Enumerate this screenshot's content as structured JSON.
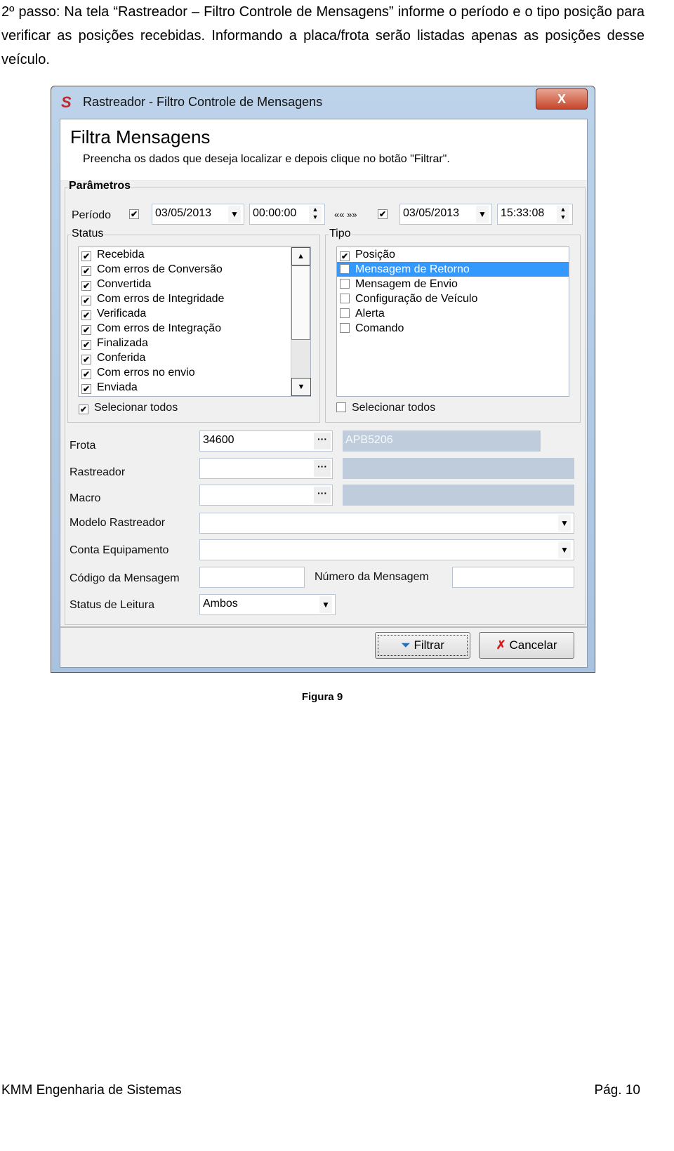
{
  "document": {
    "paragraph": "2º passo: Na tela “Rastreador – Filtro Controle de Mensagens” informe o período e o tipo posição para verificar as posições recebidas. Informando a placa/frota serão listadas apenas as posições desse veículo.",
    "caption": "Figura 9",
    "footer_left": "KMM Engenharia de Sistemas",
    "footer_right": "Pág. 10"
  },
  "window": {
    "title": "Rastreador - Filtro Controle de Mensagens",
    "close": "X",
    "header_title": "Filtra Mensagens",
    "header_subtitle": "Preencha os dados que deseja localizar e depois clique no botão \"Filtrar\".",
    "params_label": "Parâmetros",
    "periodo": {
      "label": "Período",
      "start_checked": true,
      "start_date": "03/05/2013",
      "start_time": "00:00:00",
      "separator": "«« »»",
      "end_checked": true,
      "end_date": "03/05/2013",
      "end_time": "15:33:08"
    },
    "status": {
      "label": "Status",
      "items": [
        {
          "label": "Recebida",
          "checked": true
        },
        {
          "label": "Com erros de Conversão",
          "checked": true
        },
        {
          "label": "Convertida",
          "checked": true
        },
        {
          "label": "Com erros de Integridade",
          "checked": true
        },
        {
          "label": "Verificada",
          "checked": true
        },
        {
          "label": "Com erros de Integração",
          "checked": true
        },
        {
          "label": "Finalizada",
          "checked": true
        },
        {
          "label": "Conferida",
          "checked": true
        },
        {
          "label": "Com erros no envio",
          "checked": true
        },
        {
          "label": "Enviada",
          "checked": true
        }
      ],
      "select_all": "Selecionar todos",
      "select_all_checked": true
    },
    "tipo": {
      "label": "Tipo",
      "items": [
        {
          "label": "Posição",
          "checked": true,
          "selected": false
        },
        {
          "label": "Mensagem de Retorno",
          "checked": false,
          "selected": true
        },
        {
          "label": "Mensagem de Envio",
          "checked": false,
          "selected": false
        },
        {
          "label": "Configuração de Veículo",
          "checked": false,
          "selected": false
        },
        {
          "label": "Alerta",
          "checked": false,
          "selected": false
        },
        {
          "label": "Comando",
          "checked": false,
          "selected": false
        }
      ],
      "select_all": "Selecionar todos",
      "select_all_checked": false
    },
    "fields": {
      "frota": {
        "label": "Frota",
        "value": "34600",
        "desc": "APB5206"
      },
      "rastreador": {
        "label": "Rastreador",
        "value": "",
        "desc": ""
      },
      "macro": {
        "label": "Macro",
        "value": "",
        "desc": ""
      },
      "modelo": {
        "label": "Modelo Rastreador",
        "value": ""
      },
      "conta": {
        "label": "Conta Equipamento",
        "value": ""
      },
      "codigo": {
        "label": "Código da Mensagem",
        "value": ""
      },
      "numero": {
        "label": "Número da Mensagem",
        "value": ""
      },
      "leitura": {
        "label": "Status de Leitura",
        "value": "Ambos"
      }
    },
    "buttons": {
      "filtrar": "Filtrar",
      "cancelar": "Cancelar"
    },
    "lookup_symbol": "···"
  }
}
